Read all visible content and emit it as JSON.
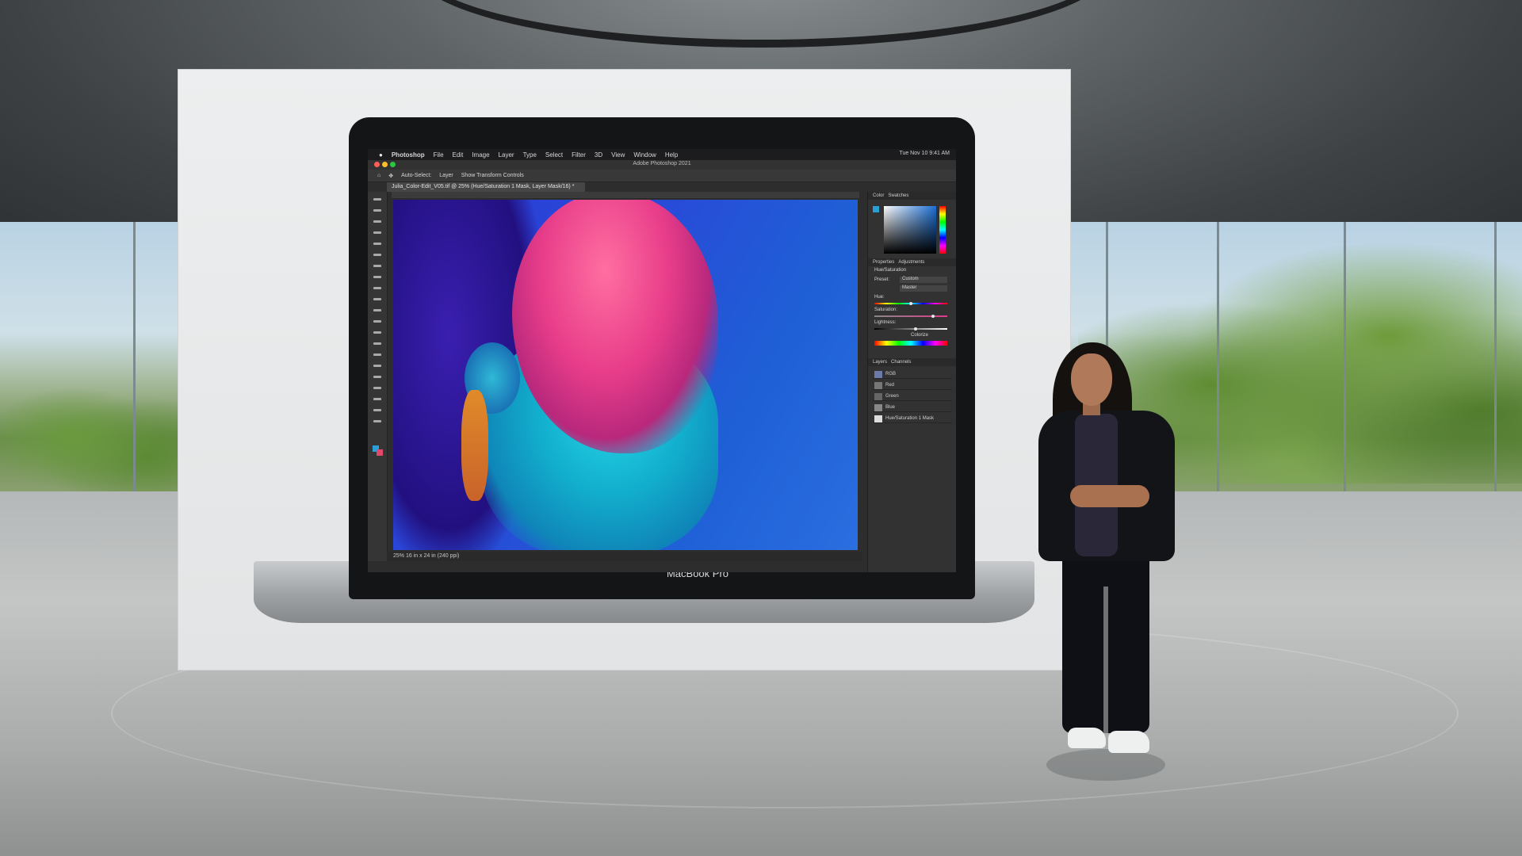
{
  "screen": {
    "menubar": {
      "apple": "",
      "items": [
        "Photoshop",
        "File",
        "Edit",
        "Image",
        "Layer",
        "Type",
        "Select",
        "Filter",
        "3D",
        "View",
        "Window",
        "Help"
      ],
      "status_right": "Tue Nov 10  9:41 AM"
    },
    "window_title": "Adobe Photoshop 2021",
    "options_bar": {
      "auto_select": "Auto-Select:",
      "layer": "Layer",
      "transform": "Show Transform Controls"
    },
    "doc_tab": "Julia_Color-Edit_V05.tif @ 25% (Hue/Saturation 1 Mask, Layer Mask/16) *",
    "status_bottom": "25%      16 in x 24 in (240 ppi)",
    "panels": {
      "color_tab": "Color",
      "swatches_tab": "Swatches",
      "properties_tab": "Properties",
      "adjustments_tab": "Adjustments",
      "hue_saturation": "Hue/Saturation",
      "preset": "Preset:",
      "preset_value": "Custom",
      "master": "Master",
      "hue": "Hue:",
      "saturation": "Saturation:",
      "lightness": "Lightness:",
      "colorize": "Colorize",
      "layers_tab": "Layers",
      "channels_tab": "Channels",
      "channels": [
        "RGB",
        "Red",
        "Green",
        "Blue",
        "Hue/Saturation 1 Mask"
      ]
    }
  },
  "laptop": {
    "brand": "MacBook Pro"
  },
  "colors": {
    "traffic_red": "#ff5f57",
    "traffic_yellow": "#febc2e",
    "traffic_green": "#28c840"
  }
}
